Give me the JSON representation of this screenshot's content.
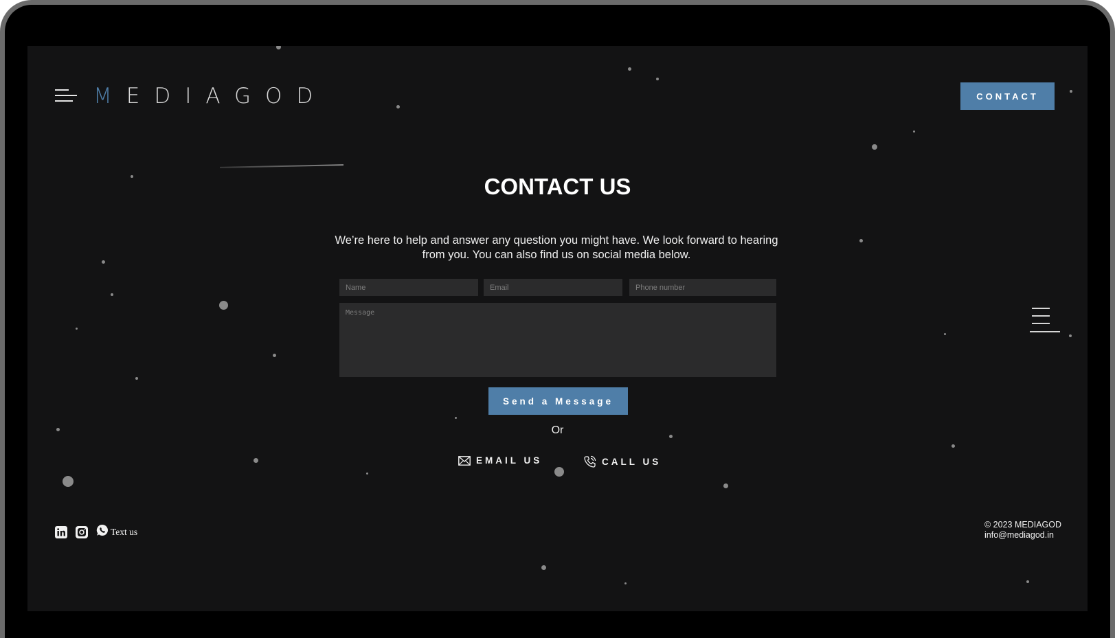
{
  "header": {
    "logo_first_letter": "M",
    "logo_rest": "EDIAGOD",
    "contact_button": "CONTACT"
  },
  "main": {
    "title": "CONTACT US",
    "intro": "We’re here to help and answer any question you might have. We look forward to hearing from you. You can also find us on social media below.",
    "form": {
      "name_placeholder": "Name",
      "email_placeholder": "Email",
      "phone_placeholder": "Phone number",
      "message_placeholder": "Message",
      "submit_label": "Send a Message"
    },
    "or_text": "Or",
    "email_us_label": "EMAIL US",
    "call_us_label": "CALL US"
  },
  "footer": {
    "social_icons": [
      "linkedin-icon",
      "instagram-icon",
      "whatsapp-icon"
    ],
    "text_us_label": "Text us",
    "copyright": "© 2023 MEDIAGOD",
    "email": "info@mediagod.in"
  },
  "colors": {
    "background": "#131314",
    "accent": "#4f7ea8",
    "field": "#2b2b2c",
    "text": "#f1f1f1"
  }
}
